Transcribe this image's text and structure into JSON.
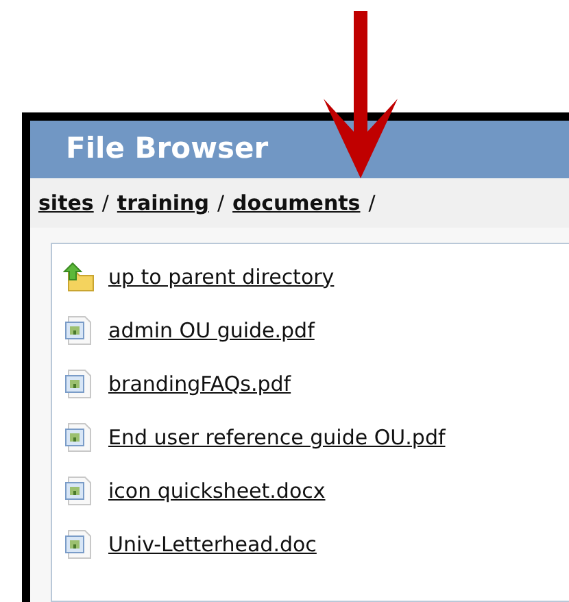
{
  "window": {
    "title": "File Browser"
  },
  "breadcrumb": [
    {
      "label": "sites",
      "separator": "/"
    },
    {
      "label": "training",
      "separator": "/"
    },
    {
      "label": "documents",
      "separator": "/"
    }
  ],
  "files": [
    {
      "kind": "parent",
      "name": "up to parent directory"
    },
    {
      "kind": "file",
      "name": "admin OU guide.pdf"
    },
    {
      "kind": "file",
      "name": "brandingFAQs.pdf"
    },
    {
      "kind": "file",
      "name": "End user reference guide OU.pdf"
    },
    {
      "kind": "file",
      "name": "icon quicksheet.docx"
    },
    {
      "kind": "file",
      "name": "Univ-Letterhead.doc"
    }
  ]
}
